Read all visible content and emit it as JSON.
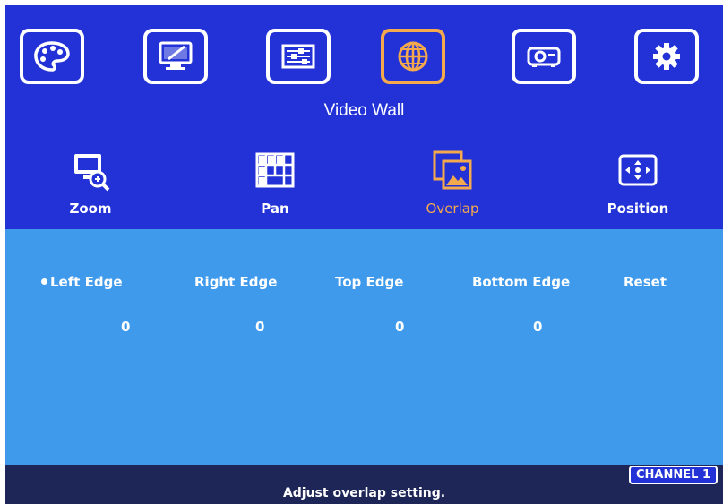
{
  "menu": {
    "title": "Video Wall",
    "main_icons": [
      {
        "name": "palette-icon",
        "selected": false
      },
      {
        "name": "monitor-edit-icon",
        "selected": false
      },
      {
        "name": "sliders-icon",
        "selected": false
      },
      {
        "name": "globe-icon",
        "selected": true
      },
      {
        "name": "projector-icon",
        "selected": false
      },
      {
        "name": "gear-icon",
        "selected": false
      }
    ],
    "accent_color": "#f3a94c"
  },
  "submenu": {
    "items": [
      {
        "label": "Zoom",
        "icon": "zoom-icon",
        "active": false
      },
      {
        "label": "Pan",
        "icon": "grid-icon",
        "active": false
      },
      {
        "label": "Overlap",
        "icon": "overlap-icon",
        "active": true
      },
      {
        "label": "Position",
        "icon": "position-icon",
        "active": false
      }
    ]
  },
  "settings": {
    "columns": [
      {
        "label": "Left Edge",
        "value": "0",
        "selected": true
      },
      {
        "label": "Right Edge",
        "value": "0",
        "selected": false
      },
      {
        "label": "Top Edge",
        "value": "0",
        "selected": false
      },
      {
        "label": "Bottom Edge",
        "value": "0",
        "selected": false
      },
      {
        "label": "Reset",
        "value": "",
        "selected": false
      }
    ]
  },
  "status": {
    "channel": "CHANNEL 1",
    "hint": "Adjust overlap setting."
  },
  "colors": {
    "top_panel": "#2332d6",
    "settings_panel": "#3f9aeb",
    "status_bar": "#1d2656"
  }
}
